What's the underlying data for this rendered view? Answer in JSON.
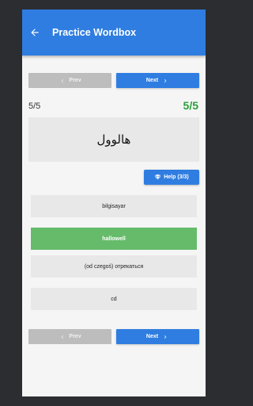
{
  "app": {
    "title": "Practice Wordbox"
  },
  "nav": {
    "prev_label": "Prev",
    "next_label": "Next"
  },
  "progress": {
    "current_label": "5/5",
    "score_label": "5/5"
  },
  "question": {
    "word": "هالوول"
  },
  "help": {
    "label": "Help (3/3)"
  },
  "options": [
    {
      "text": "bilgisayar",
      "state": "default"
    },
    {
      "text": "hallowell",
      "state": "correct"
    },
    {
      "text": "(od czegoś) отрекаться",
      "state": "default"
    },
    {
      "text": "cd",
      "state": "default"
    }
  ],
  "colors": {
    "primary": "#2f7de1",
    "success": "#2e9d3a",
    "correct_option": "#66bb6a",
    "disabled": "#bdbdbd"
  },
  "icons": {
    "back": "arrow-left-icon",
    "prev": "chevron-left-icon",
    "next": "chevron-right-icon",
    "help": "diamond-icon"
  }
}
